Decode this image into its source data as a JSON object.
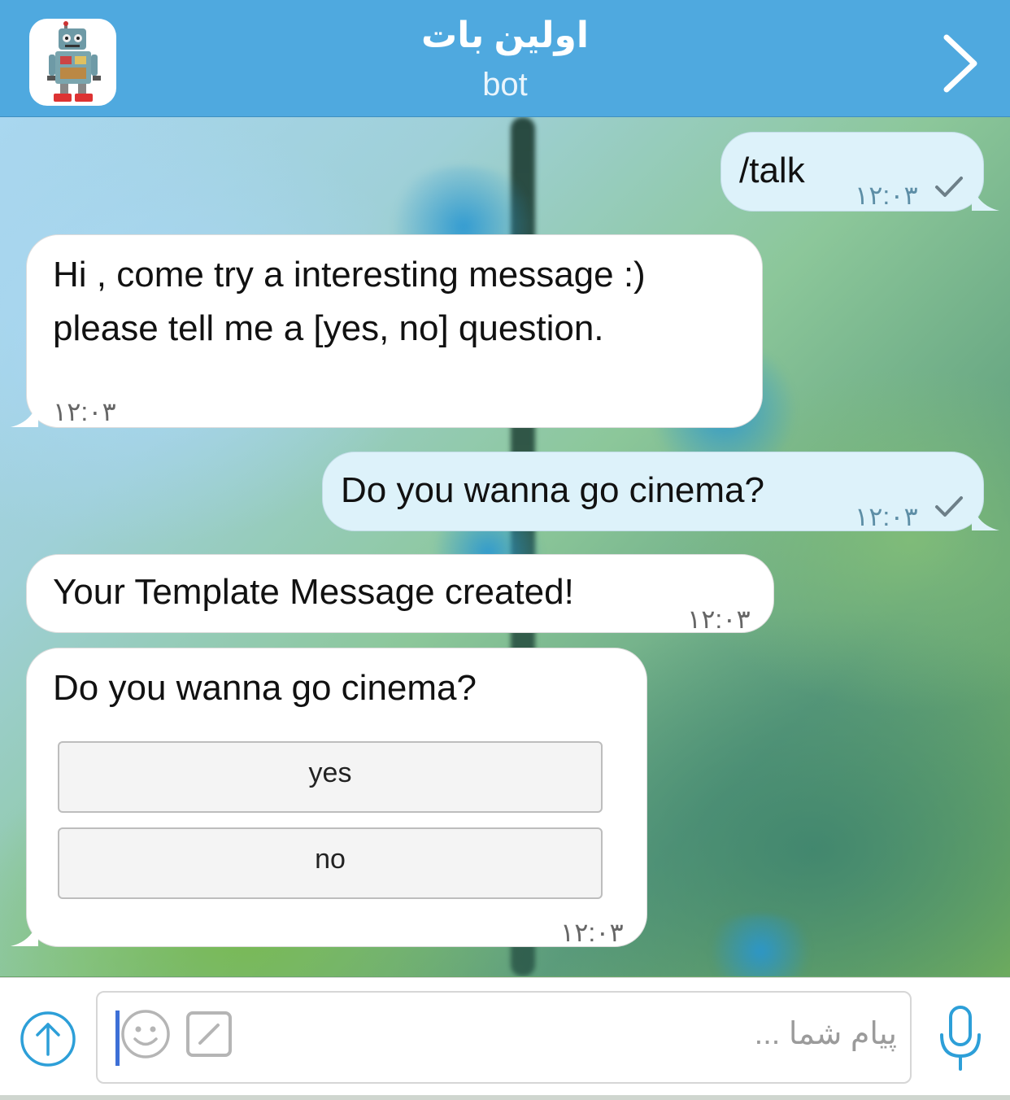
{
  "header": {
    "title": "اولین بات",
    "subtitle": "bot",
    "avatar_icon": "robot-icon",
    "back_icon": "chevron-right-icon",
    "color": "#4fa9df"
  },
  "messages": [
    {
      "direction": "outgoing",
      "text": "/talk",
      "time": "۱۲:۰۳",
      "status": "sent"
    },
    {
      "direction": "incoming",
      "lines": [
        "Hi , come try a interesting message :)",
        "please tell me a [yes, no] question."
      ],
      "time": "۱۲:۰۳"
    },
    {
      "direction": "outgoing",
      "text": "Do you wanna go cinema?",
      "time": "۱۲:۰۳",
      "status": "sent"
    },
    {
      "direction": "incoming",
      "text": "Your Template Message created!",
      "time": "۱۲:۰۳"
    },
    {
      "direction": "incoming",
      "text": "Do you wanna go cinema?",
      "time": "۱۲:۰۳",
      "buttons": [
        "yes",
        "no"
      ]
    }
  ],
  "input": {
    "placeholder": "پیام شما ...",
    "attach_icon": "upload-arrow-icon",
    "emoji_icon": "smiley-icon",
    "command_icon": "slash-command-icon",
    "mic_icon": "microphone-icon",
    "accent": "#2d9fd8"
  }
}
